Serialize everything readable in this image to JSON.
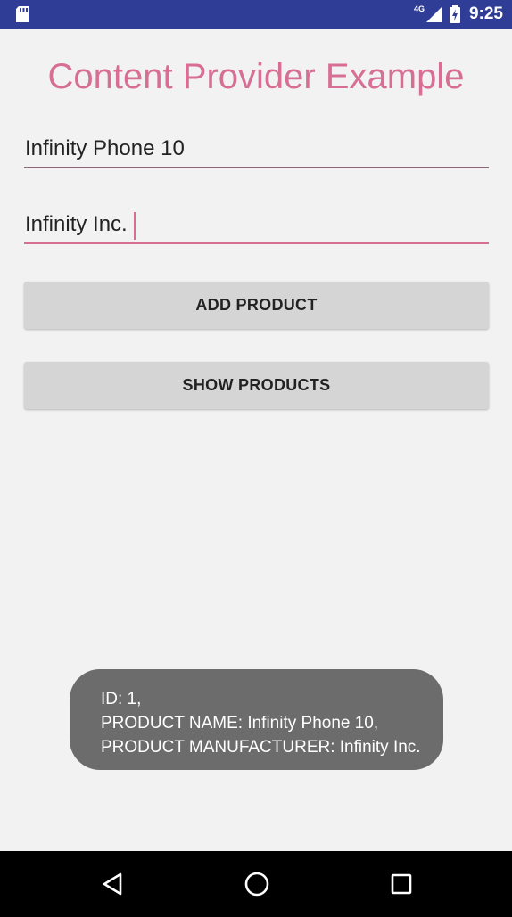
{
  "status_bar": {
    "network_label": "4G",
    "time": "9:25"
  },
  "app": {
    "title": "Content Provider Example"
  },
  "form": {
    "product_name_value": "Infinity Phone 10",
    "manufacturer_value": "Infinity Inc."
  },
  "buttons": {
    "add_label": "ADD PRODUCT",
    "show_label": "SHOW PRODUCTS"
  },
  "toast": {
    "lines": [
      "ID: 1,",
      "PRODUCT NAME: Infinity Phone 10,",
      "PRODUCT MANUFACTURER: Infinity Inc."
    ]
  },
  "navigation": {
    "back_icon": "back-triangle",
    "home_icon": "home-circle",
    "recents_icon": "recents-square"
  },
  "colors": {
    "status_bar": "#2f3d97",
    "accent": "#d66f93",
    "background": "#f2f2f2",
    "button": "#d6d5d6",
    "toast": "#6c6c6c"
  }
}
